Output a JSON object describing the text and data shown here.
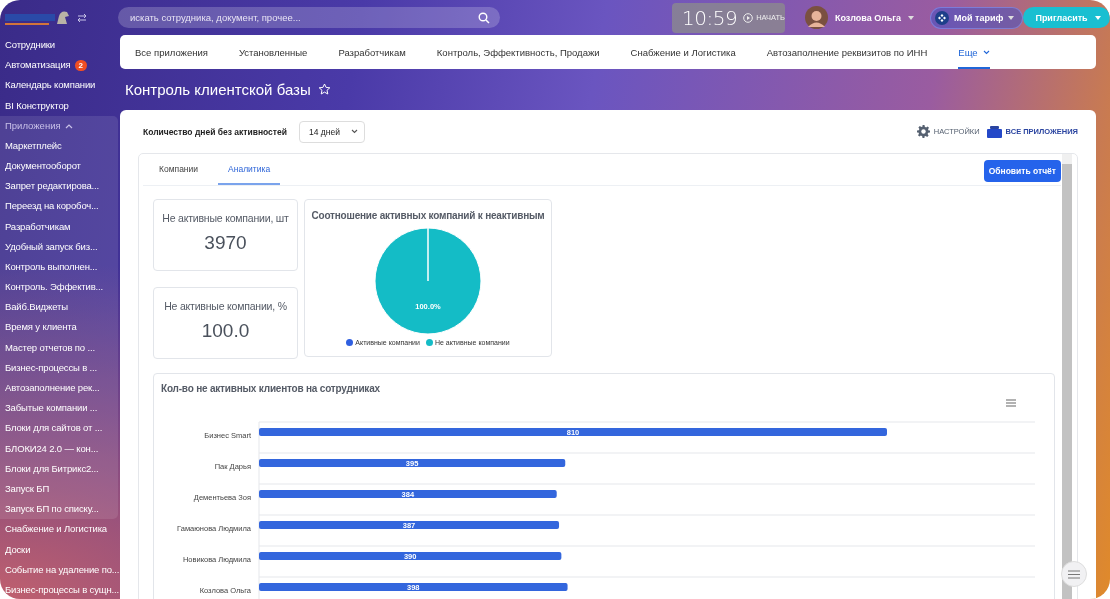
{
  "search": {
    "placeholder": "искать сотрудника, документ, прочее..."
  },
  "clock": {
    "time": "10:59",
    "action": "НАЧАТЬ"
  },
  "user": {
    "name": "Козлова Ольга"
  },
  "plan_button": "Мой тариф",
  "invite_button": "Пригласить",
  "sidebar": {
    "items": [
      {
        "kind": "link",
        "label": "Сотрудники"
      },
      {
        "kind": "link",
        "label": "Автоматизация",
        "badge": "2"
      },
      {
        "kind": "link",
        "label": "Календарь компании"
      },
      {
        "kind": "link",
        "label": "BI Конструктор"
      },
      {
        "kind": "group",
        "label": "Приложения",
        "expanded": true,
        "children": [
          {
            "label": "Маркетплейс"
          },
          {
            "label": "Документооборот"
          },
          {
            "label": "Запрет редактирова..."
          },
          {
            "label": "Переезд на коробоч..."
          },
          {
            "label": "Разработчикам"
          },
          {
            "label": "Удобный запуск биз..."
          },
          {
            "label": "Контроль выполнен..."
          },
          {
            "label": "Контроль. Эффектив..."
          },
          {
            "label": "Вайб.Виджеты"
          },
          {
            "label": "Время у клиента"
          },
          {
            "label": "Мастер отчетов по ..."
          },
          {
            "label": "Бизнес-процессы в ..."
          },
          {
            "label": "Автозаполнение рек..."
          },
          {
            "label": "Забытые компании ..."
          },
          {
            "label": "Блоки для сайтов от ..."
          },
          {
            "label": "БЛОКИ24 2.0 — кон..."
          },
          {
            "label": "Блоки для Битрикс2..."
          },
          {
            "label": "Запуск БП"
          },
          {
            "label": "Запуск БП по списку..."
          }
        ]
      },
      {
        "kind": "link",
        "label": "Снабжение и Логистика"
      },
      {
        "kind": "link",
        "label": "Доски"
      },
      {
        "kind": "link",
        "label": "Событие на удаление по..."
      },
      {
        "kind": "link",
        "label": "Бизнес-процессы в сущн..."
      }
    ]
  },
  "nav_tabs": [
    {
      "label": "Все приложения",
      "selected": false
    },
    {
      "label": "Установленные",
      "selected": false
    },
    {
      "label": "Разработчикам",
      "selected": false
    },
    {
      "label": "Контроль, Эффективность, Продажи",
      "selected": false
    },
    {
      "label": "Снабжение и Логистика",
      "selected": false
    },
    {
      "label": "Автозаполнение реквизитов по ИНН",
      "selected": false
    },
    {
      "label": "Еще",
      "selected": true
    }
  ],
  "page_title": "Контроль клиентской базы",
  "filter": {
    "label": "Количество дней без активностей",
    "value": "14 дней"
  },
  "header_links": {
    "settings": "НАСТРОЙКИ",
    "all_apps": "ВСЕ ПРИЛОЖЕНИЯ"
  },
  "report_tabs": [
    {
      "label": "Компании",
      "selected": false
    },
    {
      "label": "Аналитика",
      "selected": true
    }
  ],
  "refresh_button": "Обновить отчёт",
  "stats": [
    {
      "title": "Не активные компании, шт",
      "value": "3970"
    },
    {
      "title": "Не активные компании, %",
      "value": "100.0"
    }
  ],
  "pie_card": {
    "legend": [
      {
        "color": "#2f5fe0"
      },
      {
        "color": "#14bcc6"
      }
    ],
    "chart_data": {
      "type": "pie",
      "title": "Соотношение активных компаний к неактивным",
      "categories": [
        "Активные компании",
        "Не активные компании"
      ],
      "values": [
        0,
        100
      ],
      "value_labels": [
        null,
        "100.0%"
      ]
    }
  },
  "bar_card": {
    "chart_data": {
      "type": "bar",
      "orientation": "horizontal",
      "title": "Кол-во не активных клиентов на сотрудниках",
      "categories": [
        "Бизнес Smart",
        "Пак Дарья",
        "Дементьева Зоя",
        "Гамаюнова Людмила",
        "Новикова Людмила",
        "Козлова Ольга"
      ],
      "values": [
        810,
        395,
        384,
        387,
        390,
        398
      ],
      "data_labels": true
    }
  }
}
